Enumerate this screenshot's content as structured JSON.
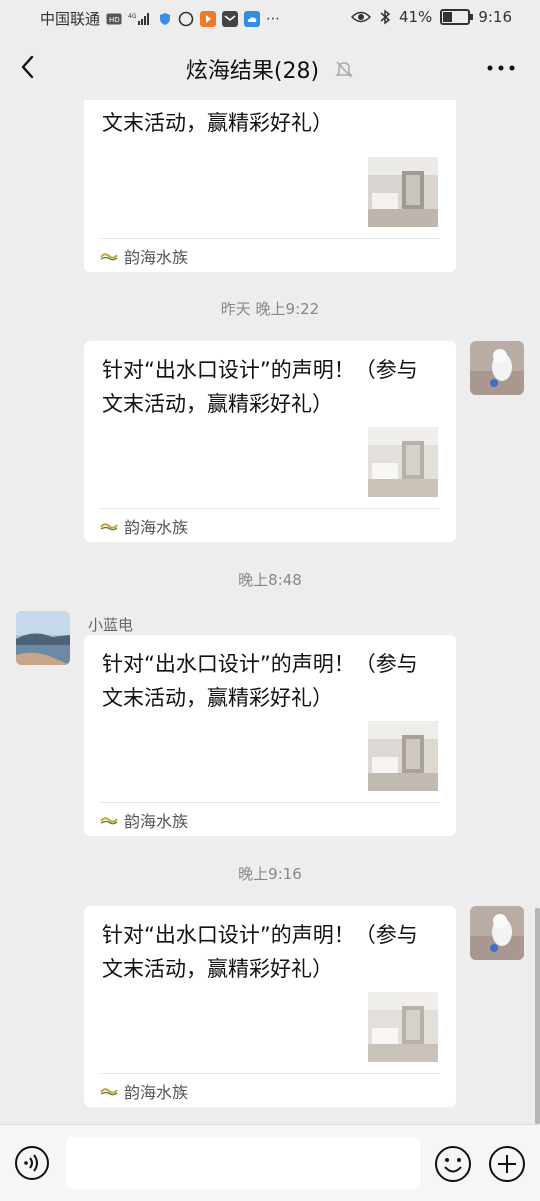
{
  "status_bar": {
    "carrier": "中国联通",
    "battery_text": "41%",
    "battery_level": 0.41,
    "time": "9:16"
  },
  "header": {
    "title": "炫海结果(28)"
  },
  "shared_card": {
    "title": "针对“出水口设计”的声明！（参与文末活动，赢精彩好礼）",
    "source_name": "韵海水族"
  },
  "timestamps": {
    "t1": "昨天 晚上9:22",
    "t2": "晚上8:48",
    "t3": "晚上9:16"
  },
  "senders": {
    "other_name": "小蓝电"
  },
  "input": {
    "placeholder": ""
  },
  "icons": {
    "back": "chevron-left-icon",
    "mute": "bell-off-icon",
    "more": "more-dots-icon",
    "voice": "voice-icon",
    "emoji": "emoji-icon",
    "plus": "plus-icon"
  },
  "colors": {
    "background": "#ededed",
    "card": "#ffffff",
    "accent_logo": "#c8a23a"
  }
}
